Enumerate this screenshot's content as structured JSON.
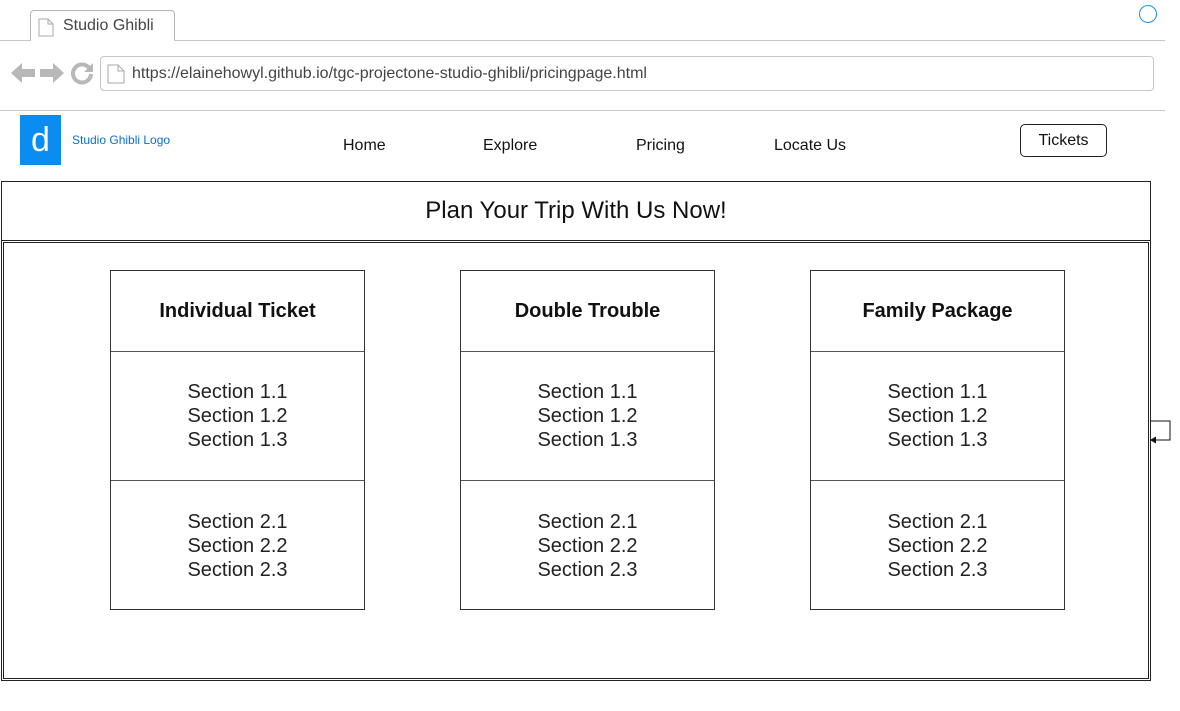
{
  "browser": {
    "tab_title": "Studio Ghibli",
    "url": "https://elainehowyl.github.io/tgc-projectone-studio-ghibli/pricingpage.html",
    "icons": [
      "back-icon",
      "forward-icon",
      "reload-icon",
      "document-icon",
      "window-control-circle"
    ]
  },
  "header": {
    "logo_letter": "d",
    "logo_text": "Studio Ghibli Logo",
    "nav": [
      "Home",
      "Explore",
      "Pricing",
      "Locate Us"
    ],
    "tickets_label": "Tickets"
  },
  "main": {
    "title": "Plan Your Trip With Us Now!",
    "cards": [
      {
        "title": "Individual Ticket",
        "section1": [
          "Section 1.1",
          "Section 1.2",
          "Section 1.3"
        ],
        "section2": [
          "Section 2.1",
          "Section 2.2",
          "Section 2.3"
        ]
      },
      {
        "title": "Double Trouble",
        "section1": [
          "Section 1.1",
          "Section 1.2",
          "Section 1.3"
        ],
        "section2": [
          "Section 2.1",
          "Section 2.2",
          "Section 2.3"
        ]
      },
      {
        "title": "Family Package",
        "section1": [
          "Section 1.1",
          "Section 1.2",
          "Section 1.3"
        ],
        "section2": [
          "Section 2.1",
          "Section 2.2",
          "Section 2.3"
        ]
      }
    ]
  },
  "colors": {
    "logo_blue": "#0a8cf0",
    "logo_text_blue": "#0a6fd0",
    "chrome_gray": "#c6c6c6",
    "nav_icon_gray": "#b8b8b8"
  }
}
